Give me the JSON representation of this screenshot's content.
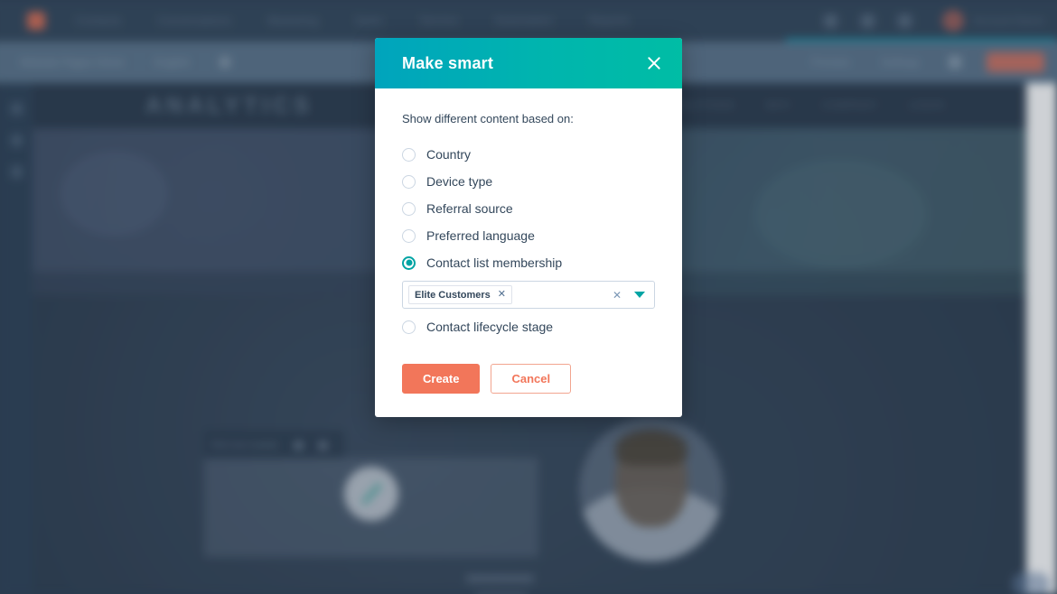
{
  "background": {
    "top_nav": {
      "logo_icon": "sprocket-logo-icon",
      "items": [
        "Contacts",
        "Conversations",
        "Marketing",
        "Sales",
        "Service",
        "Automation",
        "Reports"
      ],
      "icons": [
        "marketplace-icon",
        "notifications-icon",
        "settings-icon"
      ],
      "user_name": "Account Name"
    },
    "sub_bar": {
      "breadcrumb": "Website Pages Home",
      "page_name": "English",
      "page_icon": "globe-icon",
      "actions": [
        "Preview",
        "Settings"
      ],
      "more_icon": "more-options-icon",
      "publish_label": "Publish"
    },
    "rail": {
      "icons": [
        "content-icon",
        "design-icon",
        "settings-icon"
      ]
    },
    "site": {
      "logo_text": "ANALYTICS",
      "nav_items": [
        "SOLUTIONS",
        "WHY",
        "COMPANY",
        "LOGIN"
      ],
      "module_label": "Rich text module",
      "module_icons": [
        "duplicate-icon",
        "delete-icon"
      ],
      "edit_icon": "pencil-icon",
      "portrait": "person-portrait"
    }
  },
  "modal": {
    "title": "Make smart",
    "close_icon": "close-icon",
    "prompt": "Show different content based on:",
    "options": [
      {
        "label": "Country",
        "selected": false
      },
      {
        "label": "Device type",
        "selected": false
      },
      {
        "label": "Referral source",
        "selected": false
      },
      {
        "label": "Preferred language",
        "selected": false
      },
      {
        "label": "Contact list membership",
        "selected": true
      },
      {
        "label": "Contact lifecycle stage",
        "selected": false
      }
    ],
    "list_field": {
      "tags": [
        "Elite Customers"
      ],
      "tag_remove_icon": "close-icon",
      "clear_icon": "clear-icon",
      "dropdown_icon": "chevron-down-icon",
      "placeholder": ""
    },
    "create_label": "Create",
    "cancel_label": "Cancel",
    "colors": {
      "header_gradient_start": "#00a4bd",
      "header_gradient_end": "#00bda5",
      "accent_teal": "#00a4a4",
      "primary_orange": "#f2765a"
    }
  }
}
